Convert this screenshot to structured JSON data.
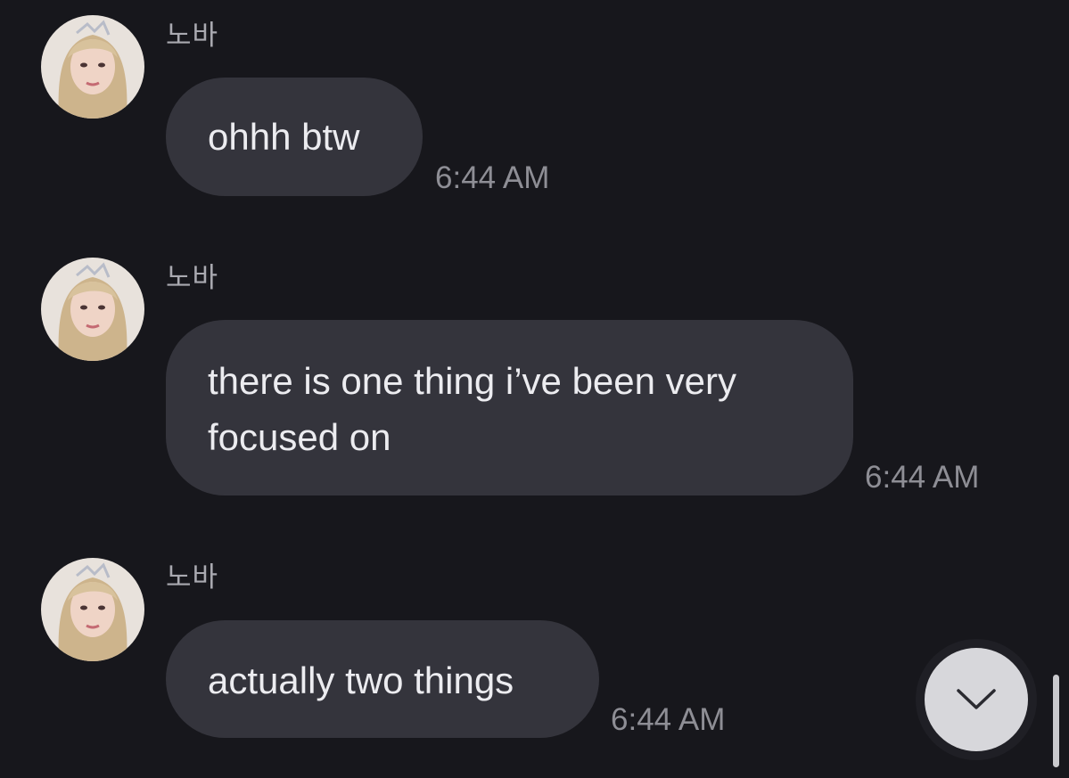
{
  "messages": [
    {
      "sender": "노바",
      "text": "ohhh btw",
      "time": "6:44 AM"
    },
    {
      "sender": "노바",
      "text": "there is one thing i've been very focused on",
      "line1": "there is one thing i’ve been very",
      "line2": "focused on",
      "time": "6:44 AM"
    },
    {
      "sender": "노바",
      "text": "actually two things",
      "time": "6:44 AM"
    }
  ],
  "controls": {
    "scroll_down_icon": "chevron-down-icon"
  },
  "colors": {
    "background": "#17171c",
    "bubble": "#34343c",
    "text": "#ececf0",
    "timestamp": "#8e8e95",
    "sender": "#a9a9b0",
    "scroll_button": "#d7d7db"
  }
}
